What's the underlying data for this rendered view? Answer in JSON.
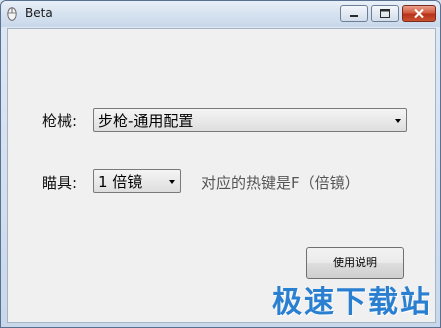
{
  "window": {
    "title": "Beta",
    "icon": "mouse-icon"
  },
  "caption_buttons": {
    "minimize": "minimize-icon",
    "maximize": "maximize-icon",
    "close": "close-icon"
  },
  "form": {
    "gun_label": "枪械:",
    "gun_selected": "步枪-通用配置",
    "scope_label": "瞄具:",
    "scope_selected": "1 倍镜",
    "hotkey_hint": "对应的热键是F（倍镜）",
    "help_button": "使用说明"
  },
  "watermark": {
    "text": "极速下载站"
  },
  "colors": {
    "close_button": "#c9502f",
    "watermark": "#2a7fd0"
  }
}
